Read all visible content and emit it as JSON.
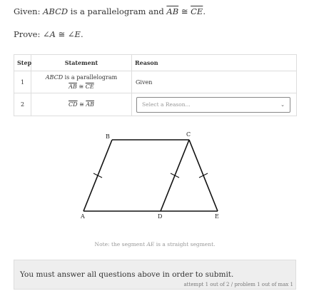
{
  "given": {
    "prefix": "Given: ",
    "figure": "ABCD",
    "middle": " is a parallelogram and ",
    "seg1": "AB",
    "cong": " ≅ ",
    "seg2": "CE",
    "end": "."
  },
  "prove": {
    "prefix": "Prove: ",
    "angle1": "∠A",
    "cong": " ≅ ",
    "angle2": "∠E",
    "end": "."
  },
  "table": {
    "headers": {
      "step": "Step",
      "statement": "Statement",
      "reason": "Reason"
    },
    "row1": {
      "step": "1",
      "figure": "ABCD",
      "text": " is a parallelogram",
      "seg1": "AB",
      "cong": " ≅ ",
      "seg2": "CE",
      "reason": "Given"
    },
    "row2": {
      "step": "2",
      "seg1": "CD",
      "cong": " ≅ ",
      "seg2": "AB",
      "reason_placeholder": "Select a Reason..."
    }
  },
  "figure": {
    "labels": {
      "A": "A",
      "B": "B",
      "C": "C",
      "D": "D",
      "E": "E"
    }
  },
  "note": {
    "prefix": "Note: the segment ",
    "segment": "AE",
    "suffix": " is a straight segment."
  },
  "submit": {
    "message": "You must answer all questions above in order to submit.",
    "attempt": "attempt 1 out of 2 / problem 1 out of max 1"
  },
  "colors": {
    "border": "#dddddd",
    "submit_bg": "#eeeeee",
    "muted_text": "#999999"
  }
}
